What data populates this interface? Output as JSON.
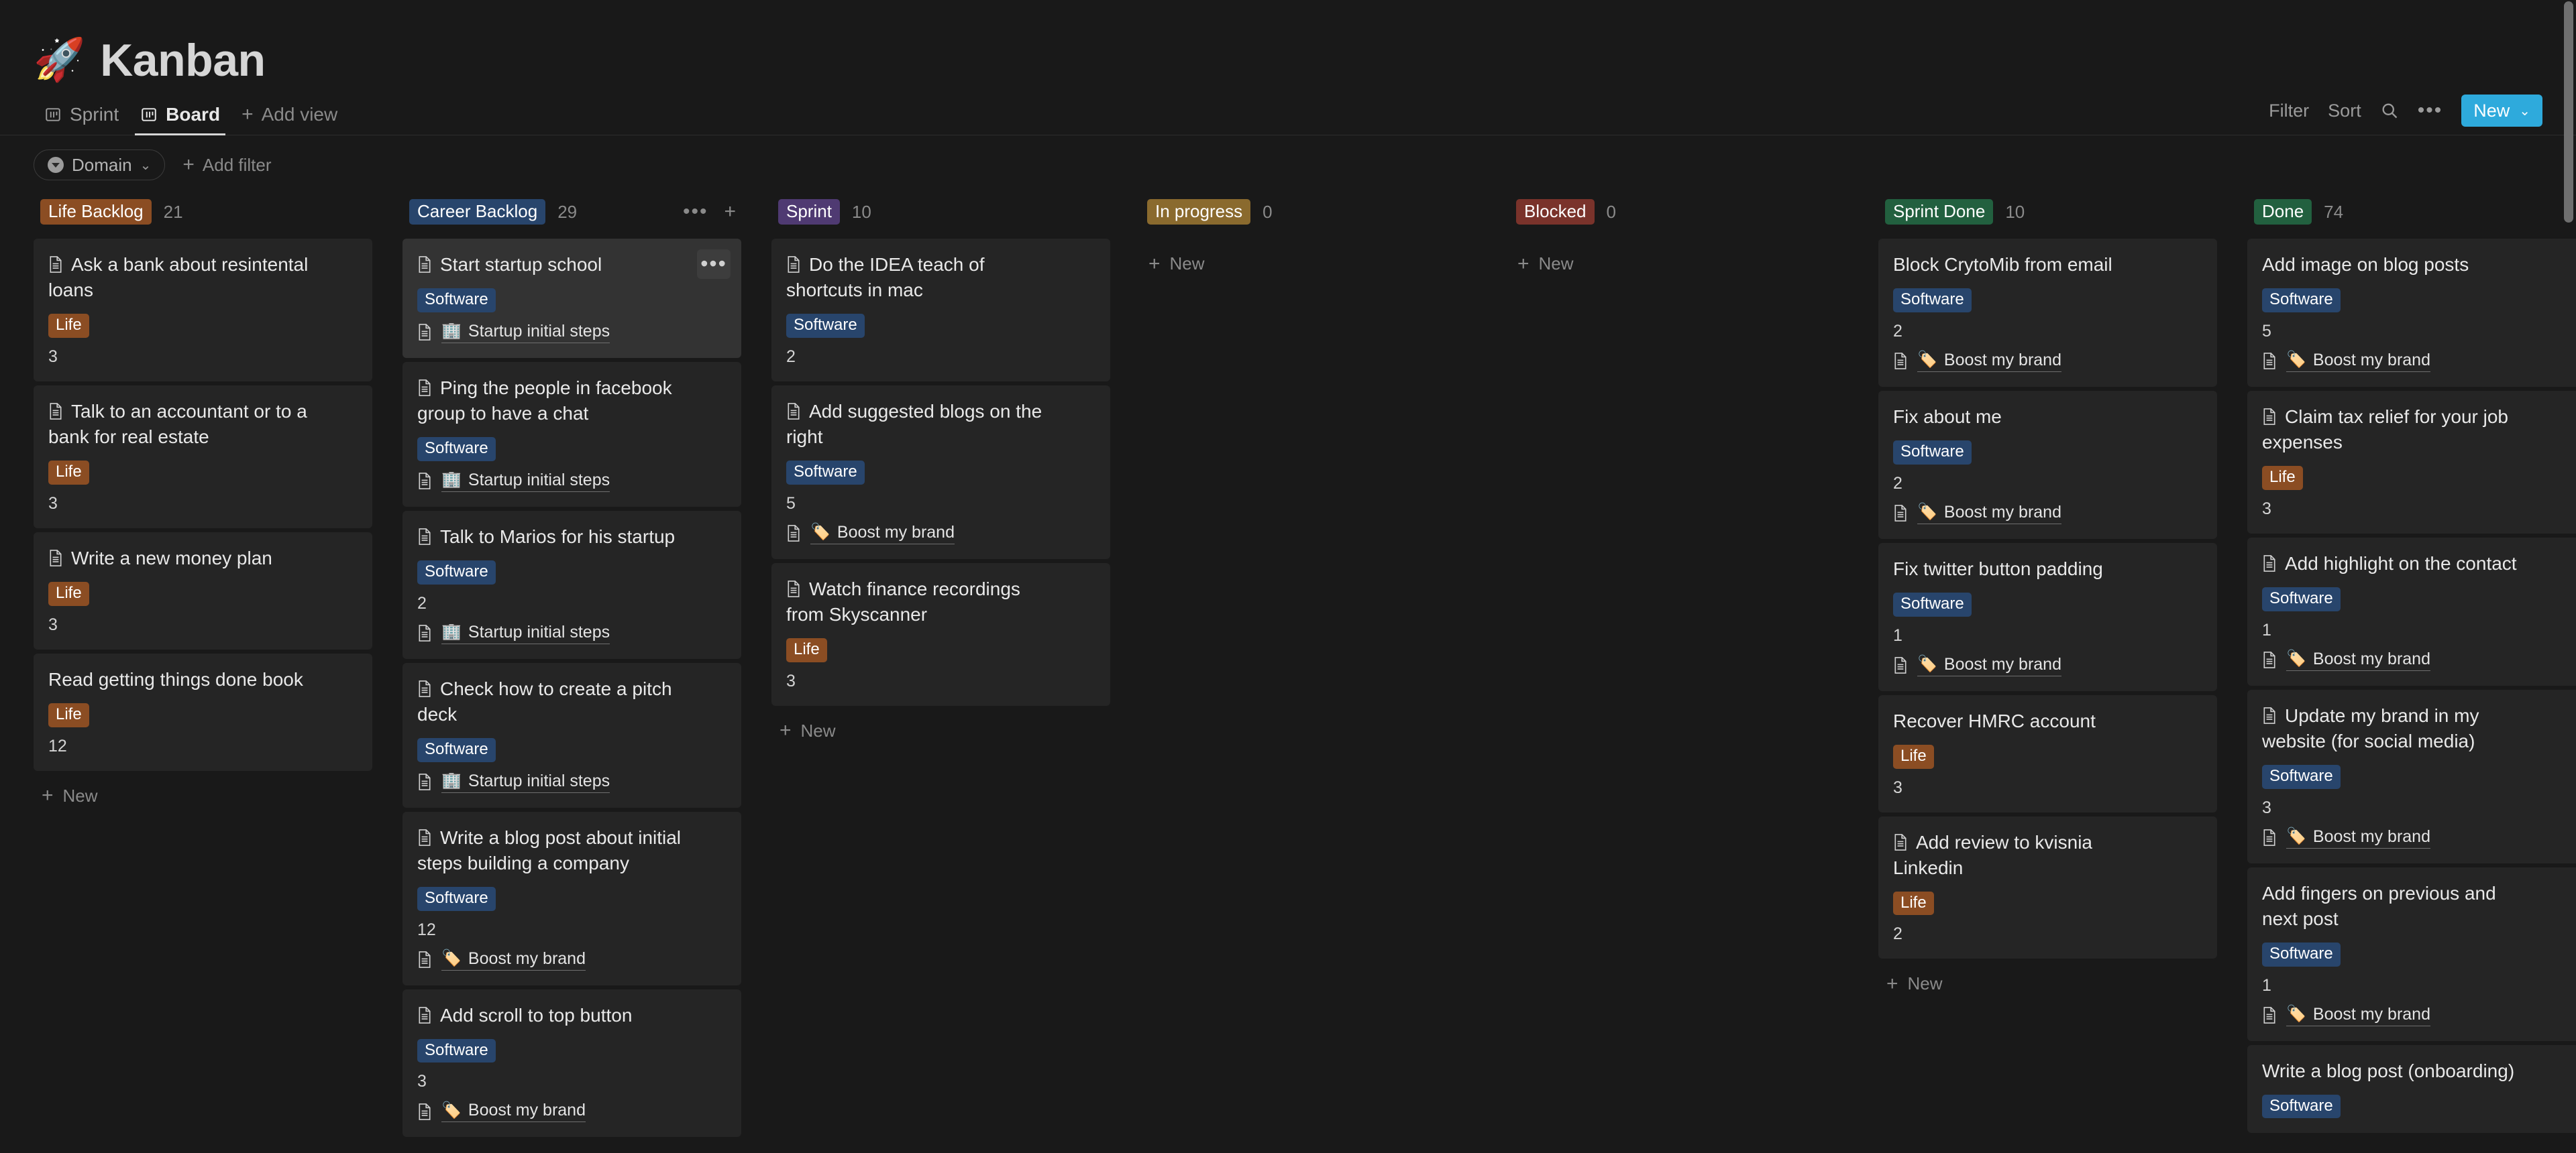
{
  "page": {
    "emoji": "🚀",
    "title": "Kanban"
  },
  "views": {
    "tabs": [
      {
        "label": "Sprint",
        "icon": "board-icon",
        "active": false
      },
      {
        "label": "Board",
        "icon": "board-icon",
        "active": true
      }
    ],
    "add_view_label": "Add view"
  },
  "toolbar": {
    "filter_label": "Filter",
    "sort_label": "Sort",
    "search_icon": "search-icon",
    "more_icon": "ellipsis-icon",
    "new_label": "New",
    "new_caret": "⌄"
  },
  "filters": {
    "domain_label": "Domain",
    "domain_caret": "⌄",
    "add_filter_label": "Add filter"
  },
  "colors": {
    "accent_blue": "#2eaadc",
    "tag_life": "#8b4d23",
    "tag_software": "#28456c",
    "pill_life_backlog": "#8b4d23",
    "pill_career_backlog": "#28456c",
    "pill_sprint": "#4f3a72",
    "pill_in_progress": "#8a6a2e",
    "pill_blocked": "#7a332b",
    "pill_sprint_done": "#22603f",
    "pill_done": "#22603f"
  },
  "new_label": "New",
  "columns": [
    {
      "name": "Life Backlog",
      "count": "21",
      "pill_color": "#8b4d23",
      "show_head_actions": false,
      "show_new": true,
      "cards": [
        {
          "title": "Ask a bank about resintental loans",
          "has_doc_icon": true,
          "tag": "Life",
          "tag_color": "#8b4d23",
          "estimate": "3",
          "relation": null,
          "hovered": false
        },
        {
          "title": "Talk to an accountant or to a bank for real estate",
          "has_doc_icon": true,
          "tag": "Life",
          "tag_color": "#8b4d23",
          "estimate": "3",
          "relation": null,
          "hovered": false
        },
        {
          "title": "Write a new money plan",
          "has_doc_icon": true,
          "tag": "Life",
          "tag_color": "#8b4d23",
          "estimate": "3",
          "relation": null,
          "hovered": false
        },
        {
          "title": "Read getting things done book",
          "has_doc_icon": false,
          "tag": "Life",
          "tag_color": "#8b4d23",
          "estimate": "12",
          "relation": null,
          "hovered": false
        }
      ]
    },
    {
      "name": "Career Backlog",
      "count": "29",
      "pill_color": "#28456c",
      "show_head_actions": true,
      "show_new": false,
      "cards": [
        {
          "title": "Start startup school",
          "has_doc_icon": true,
          "tag": "Software",
          "tag_color": "#28456c",
          "estimate": null,
          "relation": {
            "emoji": "🏢",
            "label": "Startup initial steps"
          },
          "hovered": true
        },
        {
          "title": "Ping the people in facebook group to have a chat",
          "has_doc_icon": true,
          "tag": "Software",
          "tag_color": "#28456c",
          "estimate": null,
          "relation": {
            "emoji": "🏢",
            "label": "Startup initial steps"
          },
          "hovered": false
        },
        {
          "title": "Talk to Marios for his startup",
          "has_doc_icon": true,
          "tag": "Software",
          "tag_color": "#28456c",
          "estimate": "2",
          "relation": {
            "emoji": "🏢",
            "label": "Startup initial steps"
          },
          "hovered": false
        },
        {
          "title": "Check how to create a pitch deck",
          "has_doc_icon": true,
          "tag": "Software",
          "tag_color": "#28456c",
          "estimate": null,
          "relation": {
            "emoji": "🏢",
            "label": "Startup initial steps"
          },
          "hovered": false
        },
        {
          "title": "Write a blog post about initial steps building a company",
          "has_doc_icon": true,
          "tag": "Software",
          "tag_color": "#28456c",
          "estimate": "12",
          "relation": {
            "emoji": "🏷️",
            "label": "Boost my brand"
          },
          "hovered": false
        },
        {
          "title": "Add scroll to top button",
          "has_doc_icon": true,
          "tag": "Software",
          "tag_color": "#28456c",
          "estimate": "3",
          "relation": {
            "emoji": "🏷️",
            "label": "Boost my brand"
          },
          "hovered": false
        }
      ]
    },
    {
      "name": "Sprint",
      "count": "10",
      "pill_color": "#4f3a72",
      "show_head_actions": false,
      "show_new": true,
      "cards": [
        {
          "title": "Do the IDEA teach of shortcuts in mac",
          "has_doc_icon": true,
          "tag": "Software",
          "tag_color": "#28456c",
          "estimate": "2",
          "relation": null,
          "hovered": false
        },
        {
          "title": "Add suggested blogs on the right",
          "has_doc_icon": true,
          "tag": "Software",
          "tag_color": "#28456c",
          "estimate": "5",
          "relation": {
            "emoji": "🏷️",
            "label": "Boost my brand"
          },
          "hovered": false
        },
        {
          "title": "Watch finance recordings from Skyscanner",
          "has_doc_icon": true,
          "tag": "Life",
          "tag_color": "#8b4d23",
          "estimate": "3",
          "relation": null,
          "hovered": false
        }
      ]
    },
    {
      "name": "In progress",
      "count": "0",
      "pill_color": "#8a6a2e",
      "show_head_actions": false,
      "show_new": true,
      "cards": []
    },
    {
      "name": "Blocked",
      "count": "0",
      "pill_color": "#7a332b",
      "show_head_actions": false,
      "show_new": true,
      "cards": []
    },
    {
      "name": "Sprint Done",
      "count": "10",
      "pill_color": "#22603f",
      "show_head_actions": false,
      "show_new": true,
      "cards": [
        {
          "title": "Block CrytoMib from email",
          "has_doc_icon": false,
          "tag": "Software",
          "tag_color": "#28456c",
          "estimate": "2",
          "relation": {
            "emoji": "🏷️",
            "label": "Boost my brand"
          },
          "hovered": false
        },
        {
          "title": "Fix about me",
          "has_doc_icon": false,
          "tag": "Software",
          "tag_color": "#28456c",
          "estimate": "2",
          "relation": {
            "emoji": "🏷️",
            "label": "Boost my brand"
          },
          "hovered": false
        },
        {
          "title": "Fix twitter button padding",
          "has_doc_icon": false,
          "tag": "Software",
          "tag_color": "#28456c",
          "estimate": "1",
          "relation": {
            "emoji": "🏷️",
            "label": "Boost my brand"
          },
          "hovered": false
        },
        {
          "title": "Recover HMRC account",
          "has_doc_icon": false,
          "tag": "Life",
          "tag_color": "#8b4d23",
          "estimate": "3",
          "relation": null,
          "hovered": false
        },
        {
          "title": "Add review to kvisnia Linkedin",
          "has_doc_icon": true,
          "tag": "Life",
          "tag_color": "#8b4d23",
          "estimate": "2",
          "relation": null,
          "hovered": false
        }
      ]
    },
    {
      "name": "Done",
      "count": "74",
      "pill_color": "#22603f",
      "show_head_actions": false,
      "show_new": false,
      "cards": [
        {
          "title": "Add image on blog posts",
          "has_doc_icon": false,
          "tag": "Software",
          "tag_color": "#28456c",
          "estimate": "5",
          "relation": {
            "emoji": "🏷️",
            "label": "Boost my brand"
          },
          "hovered": false
        },
        {
          "title": "Claim tax relief for your job expenses",
          "has_doc_icon": true,
          "tag": "Life",
          "tag_color": "#8b4d23",
          "estimate": "3",
          "relation": null,
          "hovered": false
        },
        {
          "title": "Add highlight on the contact",
          "has_doc_icon": true,
          "tag": "Software",
          "tag_color": "#28456c",
          "estimate": "1",
          "relation": {
            "emoji": "🏷️",
            "label": "Boost my brand"
          },
          "hovered": false
        },
        {
          "title": "Update my brand in my website (for social media)",
          "has_doc_icon": true,
          "tag": "Software",
          "tag_color": "#28456c",
          "estimate": "3",
          "relation": {
            "emoji": "🏷️",
            "label": "Boost my brand"
          },
          "hovered": false
        },
        {
          "title": "Add fingers on previous and next post",
          "has_doc_icon": false,
          "tag": "Software",
          "tag_color": "#28456c",
          "estimate": "1",
          "relation": {
            "emoji": "🏷️",
            "label": "Boost my brand"
          },
          "hovered": false
        },
        {
          "title": "Write a blog post (onboarding)",
          "has_doc_icon": false,
          "tag": "Software",
          "tag_color": "#28456c",
          "estimate": null,
          "relation": null,
          "hovered": false
        }
      ]
    }
  ]
}
